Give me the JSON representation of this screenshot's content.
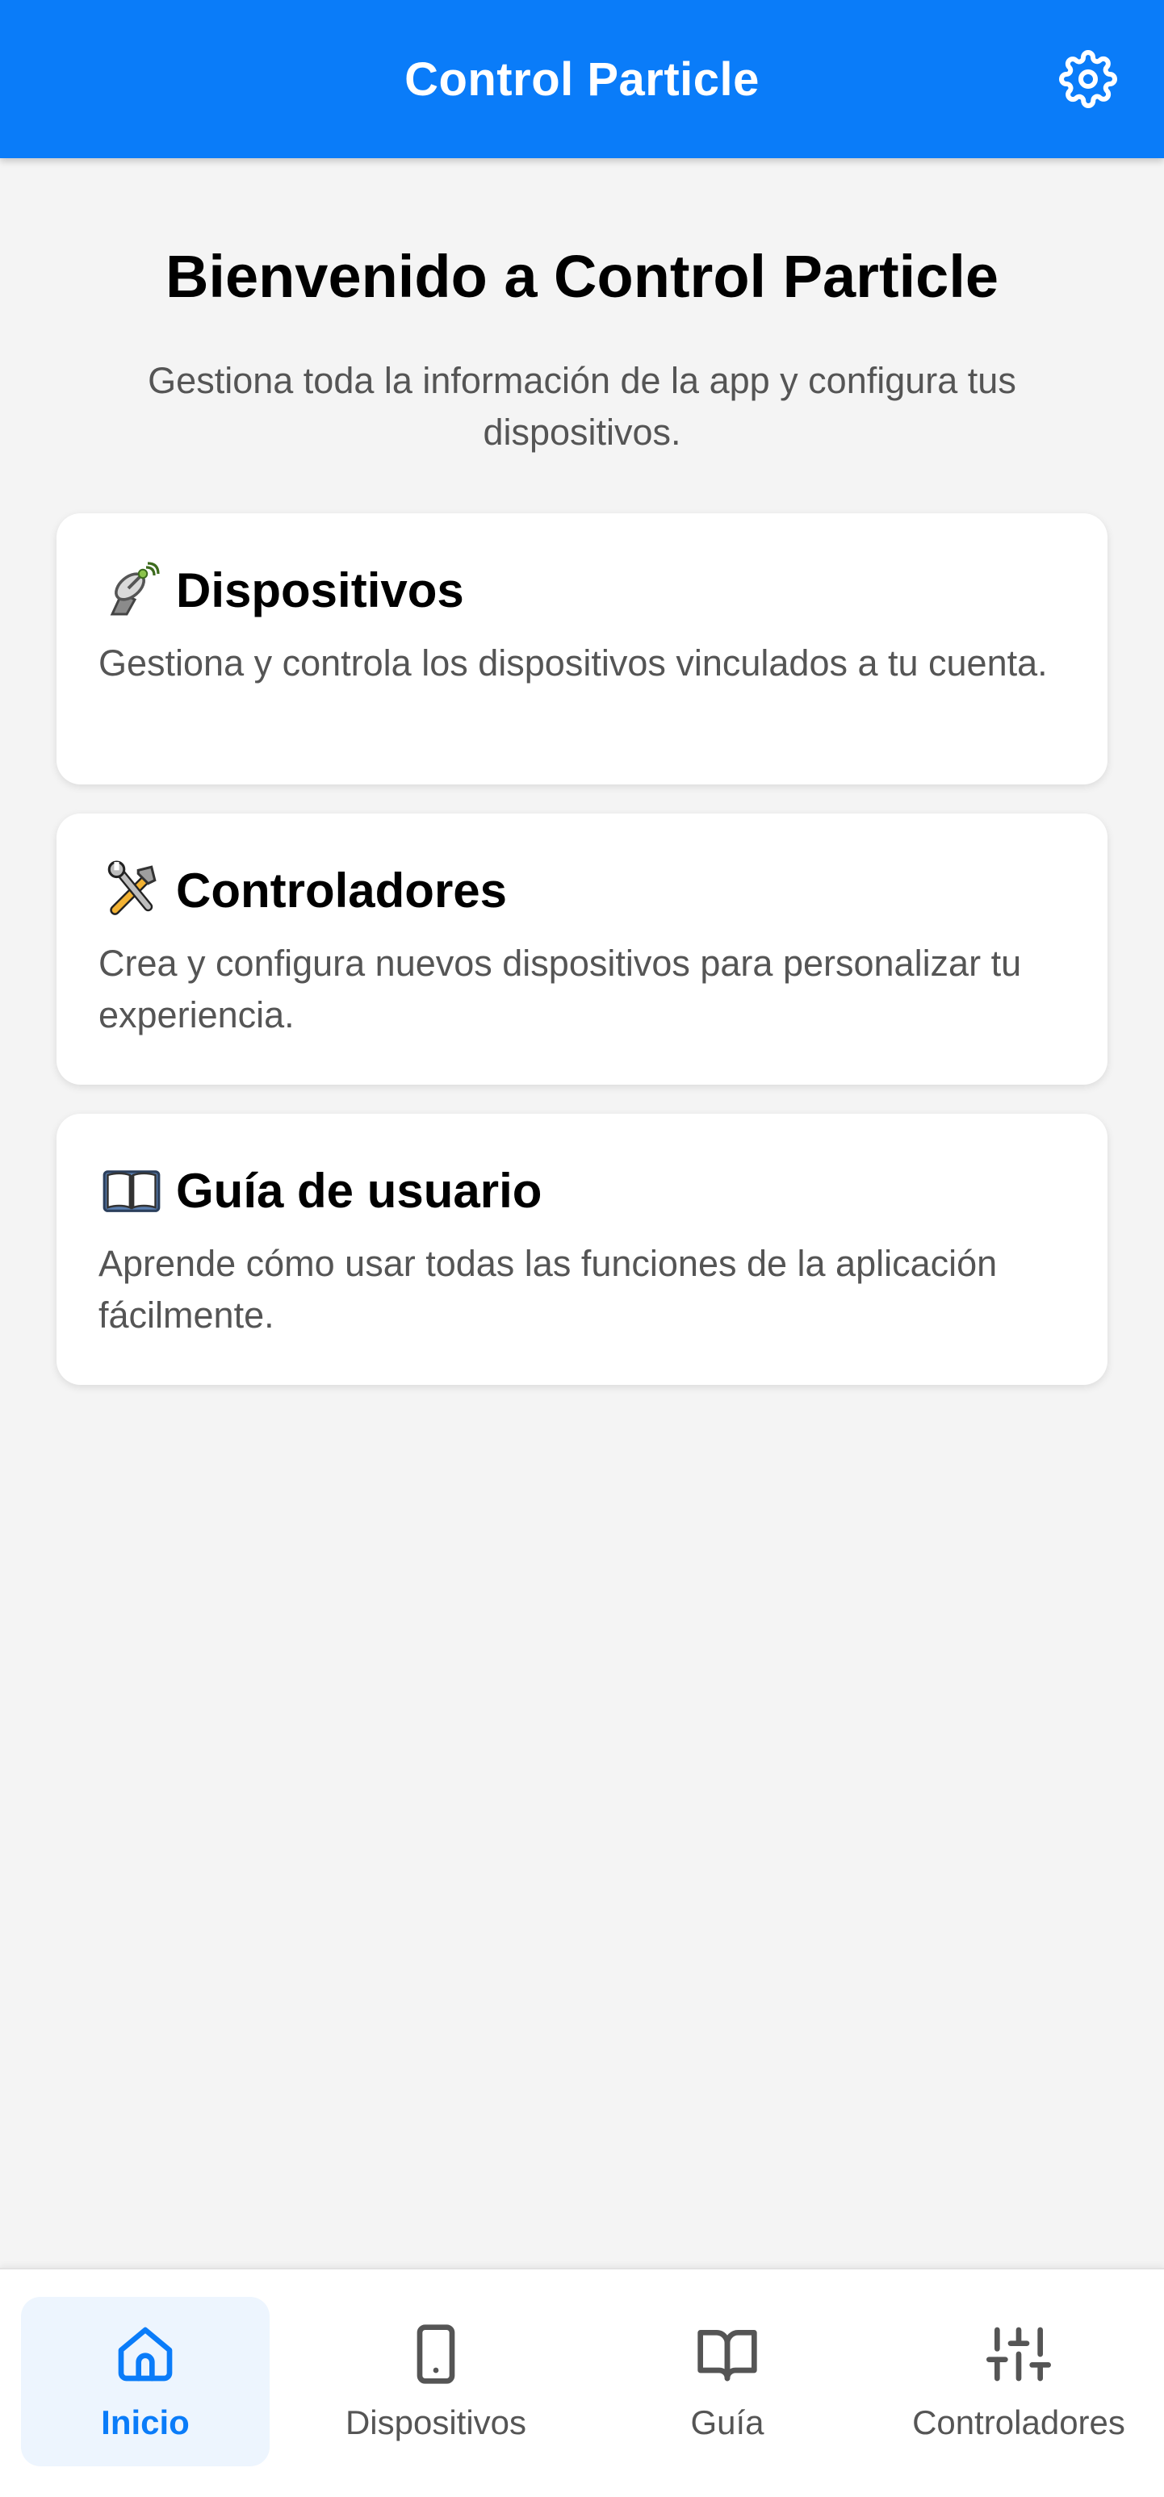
{
  "app_bar": {
    "title": "Control Particle",
    "settings_icon": "gear-icon",
    "color": "#0a7cf9"
  },
  "welcome": {
    "title": "Bienvenido a Control Particle",
    "subtitle": "Gestiona toda la información de la app y configura tus dispositivos."
  },
  "cards": [
    {
      "icon": "satellite-antenna-icon",
      "title": "Dispositivos",
      "description": "Gestiona y controla los dispositivos vinculados a tu cuenta."
    },
    {
      "icon": "hammer-and-wrench-icon",
      "title": "Controladores",
      "description": "Crea y configura nuevos dispositivos para personalizar tu experiencia."
    },
    {
      "icon": "open-book-icon",
      "title": "Guía de usuario",
      "description": "Aprende cómo usar todas las funciones de la aplicación fácilmente."
    }
  ],
  "bottom_nav": {
    "active_color": "#0a7cf9",
    "items": [
      {
        "label": "Inicio",
        "icon": "home-icon",
        "active": true
      },
      {
        "label": "Dispositivos",
        "icon": "tablet-icon",
        "active": false
      },
      {
        "label": "Guía",
        "icon": "book-icon",
        "active": false
      },
      {
        "label": "Controladores",
        "icon": "sliders-icon",
        "active": false
      }
    ]
  }
}
